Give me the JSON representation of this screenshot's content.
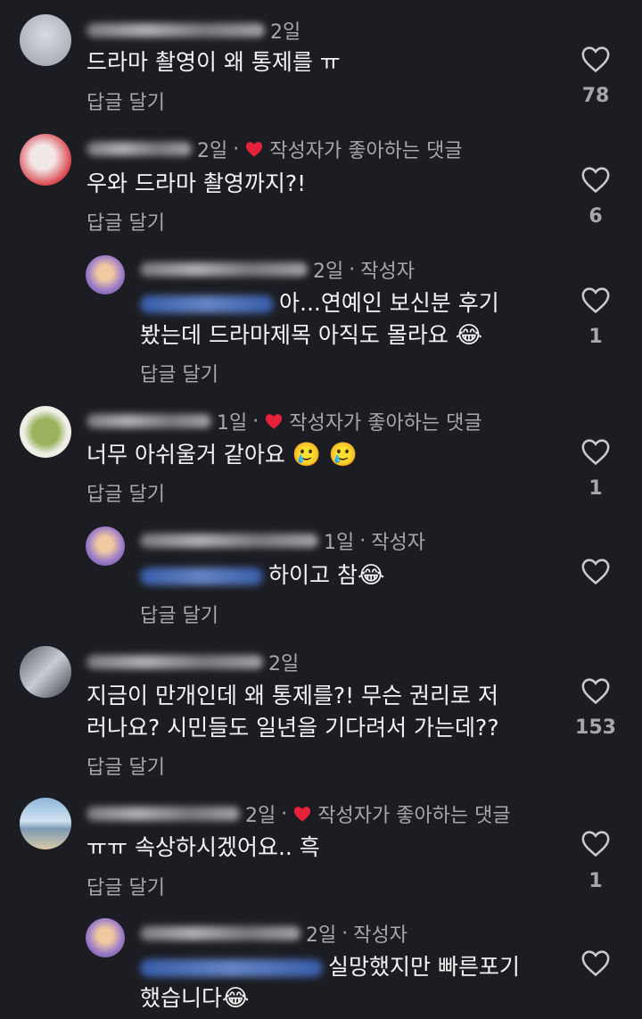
{
  "ui": {
    "reply_label": "답글 달기",
    "liked_by_author": "작성자가 좋아하는 댓글",
    "author_badge": "작성자",
    "dot": "·"
  },
  "comments": [
    {
      "time": "2일",
      "text": "드라마 촬영이 왜 통제를 ㅠ",
      "likes": "78"
    },
    {
      "time": "2일",
      "text": "우와 드라마 촬영까지?!",
      "likes": "6"
    },
    {
      "time": "2일",
      "text1": "아...연예인 보신분 후기",
      "text2": "봤는데 드라마제목 아직도 몰라요",
      "emoji": "😂",
      "likes": "1"
    },
    {
      "time": "1일",
      "text": "너무 아쉬울거 같아요",
      "emoji": "🥲 🥲",
      "likes": "1"
    },
    {
      "time": "1일",
      "text": "하이고 참",
      "emoji": "😂",
      "likes": ""
    },
    {
      "time": "2일",
      "text1": "지금이 만개인데 왜 통제를?! 무슨 권리로 저",
      "text2": "러나요? 시민들도 일년을 기다려서 가는데??",
      "likes": "153"
    },
    {
      "time": "2일",
      "text": "ㅠㅠ 속상하시겠어요.. 흑",
      "likes": "1"
    },
    {
      "time": "2일",
      "text1": "실망했지만 빠른포기",
      "text2": "했습니다",
      "emoji": "😂",
      "likes": ""
    }
  ],
  "colors": {
    "heart_red": "#e8213a",
    "link_blue": "#5b86e0"
  }
}
